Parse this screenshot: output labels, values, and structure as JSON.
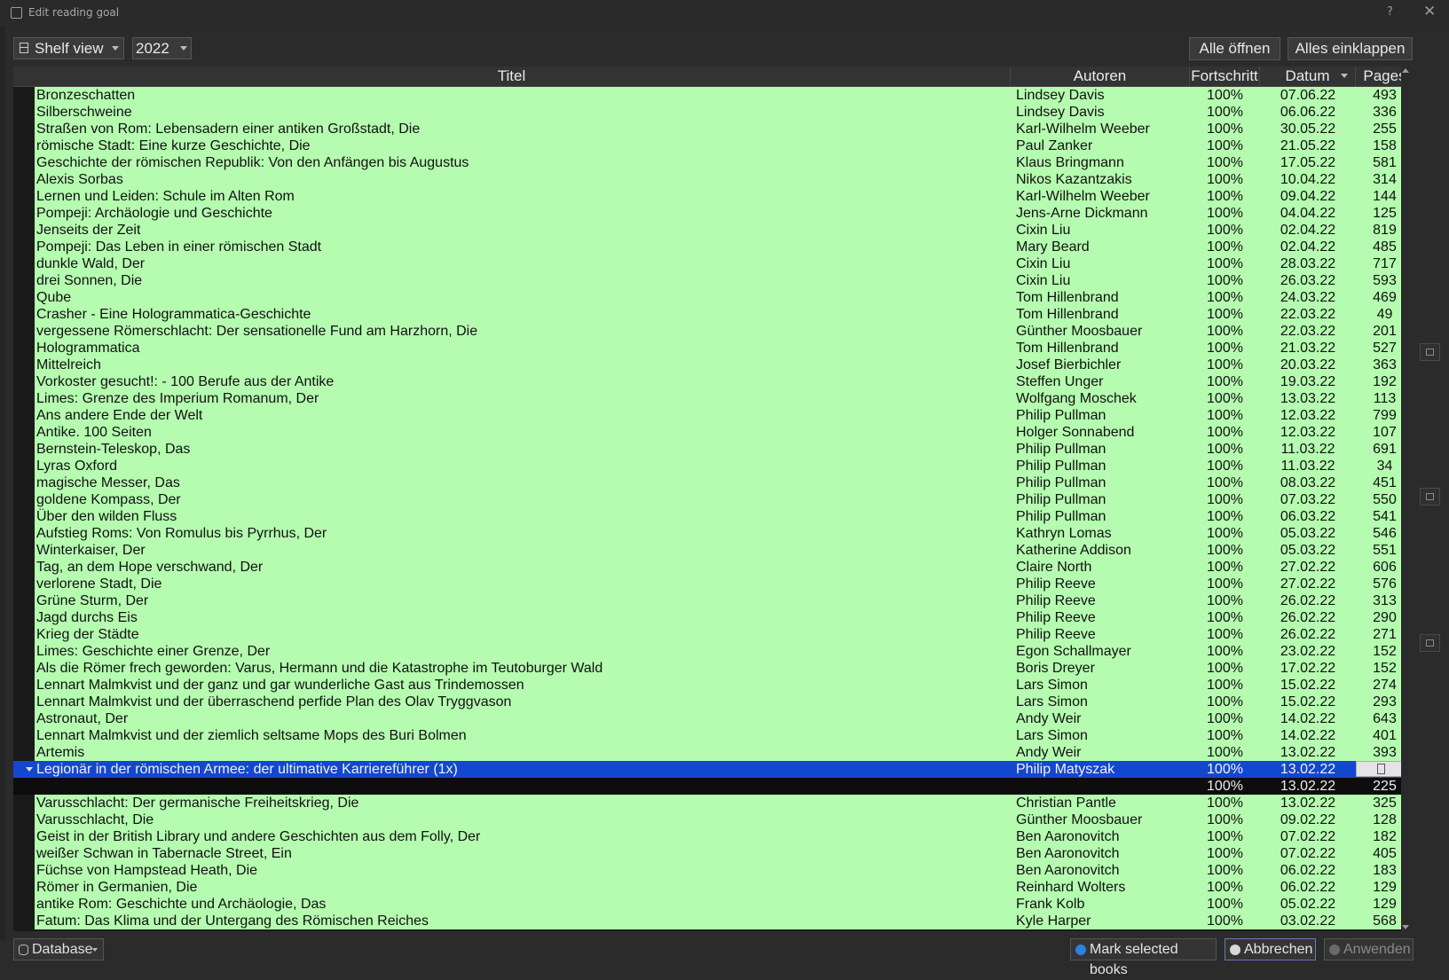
{
  "window": {
    "title": "Edit reading goal",
    "help": "?",
    "close": "✕"
  },
  "toolbar": {
    "view_mode": "Shelf view",
    "year": "2022",
    "open_all": "Alle öffnen",
    "collapse_all": "Alles einklappen"
  },
  "columns": {
    "title": "Titel",
    "authors": "Autoren",
    "progress": "Fortschritt",
    "date": "Datum",
    "pages": "Pages"
  },
  "colors": {
    "row_complete": "#b5fcb0",
    "row_selected": "#1447cf",
    "background": "#2b2b2b"
  },
  "rows": [
    {
      "title": "Bronzeschatten",
      "author": "Lindsey Davis",
      "progress": "100%",
      "date": "07.06.22",
      "pages": "493"
    },
    {
      "title": "Silberschweine",
      "author": "Lindsey Davis",
      "progress": "100%",
      "date": "06.06.22",
      "pages": "336"
    },
    {
      "title": "Straßen von Rom: Lebensadern einer antiken Großstadt, Die",
      "author": "Karl-Wilhelm Weeber",
      "progress": "100%",
      "date": "30.05.22",
      "pages": "255"
    },
    {
      "title": "römische Stadt: Eine kurze Geschichte, Die",
      "author": "Paul Zanker",
      "progress": "100%",
      "date": "21.05.22",
      "pages": "158"
    },
    {
      "title": "Geschichte der römischen Republik: Von den Anfängen bis Augustus",
      "author": "Klaus Bringmann",
      "progress": "100%",
      "date": "17.05.22",
      "pages": "581"
    },
    {
      "title": "Alexis Sorbas",
      "author": "Nikos Kazantzakis",
      "progress": "100%",
      "date": "10.04.22",
      "pages": "314"
    },
    {
      "title": "Lernen und Leiden: Schule im Alten Rom",
      "author": "Karl-Wilhelm Weeber",
      "progress": "100%",
      "date": "09.04.22",
      "pages": "144"
    },
    {
      "title": "Pompeji: Archäologie und Geschichte",
      "author": "Jens-Arne Dickmann",
      "progress": "100%",
      "date": "04.04.22",
      "pages": "125"
    },
    {
      "title": "Jenseits der Zeit",
      "author": "Cixin Liu",
      "progress": "100%",
      "date": "02.04.22",
      "pages": "819"
    },
    {
      "title": "Pompeji: Das Leben in einer römischen Stadt",
      "author": "Mary Beard",
      "progress": "100%",
      "date": "02.04.22",
      "pages": "485"
    },
    {
      "title": "dunkle Wald, Der",
      "author": "Cixin Liu",
      "progress": "100%",
      "date": "28.03.22",
      "pages": "717"
    },
    {
      "title": "drei Sonnen, Die",
      "author": "Cixin Liu",
      "progress": "100%",
      "date": "26.03.22",
      "pages": "593"
    },
    {
      "title": "Qube",
      "author": "Tom Hillenbrand",
      "progress": "100%",
      "date": "24.03.22",
      "pages": "469"
    },
    {
      "title": "Crasher - Eine Hologrammatica-Geschichte",
      "author": "Tom Hillenbrand",
      "progress": "100%",
      "date": "22.03.22",
      "pages": "49"
    },
    {
      "title": "vergessene Römerschlacht: Der sensationelle Fund am Harzhorn, Die",
      "author": "Günther Moosbauer",
      "progress": "100%",
      "date": "22.03.22",
      "pages": "201"
    },
    {
      "title": "Hologrammatica",
      "author": "Tom Hillenbrand",
      "progress": "100%",
      "date": "21.03.22",
      "pages": "527"
    },
    {
      "title": "Mittelreich",
      "author": "Josef Bierbichler",
      "progress": "100%",
      "date": "20.03.22",
      "pages": "363"
    },
    {
      "title": "Vorkoster gesucht!: - 100 Berufe aus der Antike",
      "author": "Steffen Unger",
      "progress": "100%",
      "date": "19.03.22",
      "pages": "192"
    },
    {
      "title": "Limes: Grenze des Imperium Romanum, Der",
      "author": "Wolfgang Moschek",
      "progress": "100%",
      "date": "13.03.22",
      "pages": "113"
    },
    {
      "title": "Ans andere Ende der Welt",
      "author": "Philip Pullman",
      "progress": "100%",
      "date": "12.03.22",
      "pages": "799"
    },
    {
      "title": "Antike. 100 Seiten",
      "author": "Holger Sonnabend",
      "progress": "100%",
      "date": "12.03.22",
      "pages": "107"
    },
    {
      "title": "Bernstein-Teleskop, Das",
      "author": "Philip Pullman",
      "progress": "100%",
      "date": "11.03.22",
      "pages": "691"
    },
    {
      "title": "Lyras Oxford",
      "author": "Philip Pullman",
      "progress": "100%",
      "date": "11.03.22",
      "pages": "34"
    },
    {
      "title": "magische Messer, Das",
      "author": "Philip Pullman",
      "progress": "100%",
      "date": "08.03.22",
      "pages": "451"
    },
    {
      "title": "goldene Kompass, Der",
      "author": "Philip Pullman",
      "progress": "100%",
      "date": "07.03.22",
      "pages": "550"
    },
    {
      "title": "Über den wilden Fluss",
      "author": "Philip Pullman",
      "progress": "100%",
      "date": "06.03.22",
      "pages": "541"
    },
    {
      "title": "Aufstieg Roms: Von Romulus bis Pyrrhus, Der",
      "author": "Kathryn Lomas",
      "progress": "100%",
      "date": "05.03.22",
      "pages": "546"
    },
    {
      "title": "Winterkaiser, Der",
      "author": "Katherine Addison",
      "progress": "100%",
      "date": "05.03.22",
      "pages": "551"
    },
    {
      "title": "Tag, an dem Hope verschwand, Der",
      "author": "Claire North",
      "progress": "100%",
      "date": "27.02.22",
      "pages": "606"
    },
    {
      "title": "verlorene Stadt, Die",
      "author": "Philip Reeve",
      "progress": "100%",
      "date": "27.02.22",
      "pages": "576"
    },
    {
      "title": "Grüne Sturm, Der",
      "author": "Philip Reeve",
      "progress": "100%",
      "date": "26.02.22",
      "pages": "313"
    },
    {
      "title": "Jagd durchs Eis",
      "author": "Philip Reeve",
      "progress": "100%",
      "date": "26.02.22",
      "pages": "290"
    },
    {
      "title": "Krieg der Städte",
      "author": "Philip Reeve",
      "progress": "100%",
      "date": "26.02.22",
      "pages": "271"
    },
    {
      "title": "Limes: Geschichte einer Grenze, Der",
      "author": "Egon Schallmayer",
      "progress": "100%",
      "date": "23.02.22",
      "pages": "152"
    },
    {
      "title": "Als die Römer frech geworden: Varus, Hermann und die Katastrophe im Teutoburger Wald",
      "author": "Boris Dreyer",
      "progress": "100%",
      "date": "17.02.22",
      "pages": "152"
    },
    {
      "title": "Lennart Malmkvist und der ganz und gar wunderliche Gast aus Trindemossen",
      "author": "Lars Simon",
      "progress": "100%",
      "date": "15.02.22",
      "pages": "274"
    },
    {
      "title": "Lennart Malmkvist und der überraschend perfide Plan des Olav Tryggvason",
      "author": "Lars Simon",
      "progress": "100%",
      "date": "15.02.22",
      "pages": "293"
    },
    {
      "title": "Astronaut, Der",
      "author": "Andy Weir",
      "progress": "100%",
      "date": "14.02.22",
      "pages": "643"
    },
    {
      "title": "Lennart Malmkvist und der ziemlich seltsame Mops des Buri Bolmen",
      "author": "Lars Simon",
      "progress": "100%",
      "date": "14.02.22",
      "pages": "401"
    },
    {
      "title": "Artemis",
      "author": "Andy Weir",
      "progress": "100%",
      "date": "13.02.22",
      "pages": "393"
    },
    {
      "title": "Legionär in der römischen Armee: der ultimative Karriereführer (1x)",
      "author": "Philip Matyszak",
      "progress": "100%",
      "date": "13.02.22",
      "pages": "",
      "selected": true
    },
    {
      "title": "",
      "author": "",
      "progress": "100%",
      "date": "13.02.22",
      "pages": "225",
      "child": true
    },
    {
      "title": "Varusschlacht: Der germanische Freiheitskrieg, Die",
      "author": "Christian Pantle",
      "progress": "100%",
      "date": "13.02.22",
      "pages": "325"
    },
    {
      "title": "Varusschlacht, Die",
      "author": "Günther Moosbauer",
      "progress": "100%",
      "date": "09.02.22",
      "pages": "128"
    },
    {
      "title": "Geist in der British Library und andere Geschichten aus dem Folly, Der",
      "author": "Ben Aaronovitch",
      "progress": "100%",
      "date": "07.02.22",
      "pages": "182"
    },
    {
      "title": "weißer Schwan in Tabernacle Street, Ein",
      "author": "Ben Aaronovitch",
      "progress": "100%",
      "date": "07.02.22",
      "pages": "405"
    },
    {
      "title": "Füchse von Hampstead Heath, Die",
      "author": "Ben Aaronovitch",
      "progress": "100%",
      "date": "06.02.22",
      "pages": "183"
    },
    {
      "title": "Römer in Germanien, Die",
      "author": "Reinhard Wolters",
      "progress": "100%",
      "date": "06.02.22",
      "pages": "129"
    },
    {
      "title": "antike Rom: Geschichte und Archäologie, Das",
      "author": "Frank Kolb",
      "progress": "100%",
      "date": "05.02.22",
      "pages": "129"
    },
    {
      "title": "Fatum: Das Klima und der Untergang des Römischen Reiches",
      "author": "Kyle Harper",
      "progress": "100%",
      "date": "03.02.22",
      "pages": "568"
    }
  ],
  "footer": {
    "database": "Database",
    "mark_selected": "Mark selected books",
    "cancel": "Abbrechen",
    "apply": "Anwenden"
  }
}
